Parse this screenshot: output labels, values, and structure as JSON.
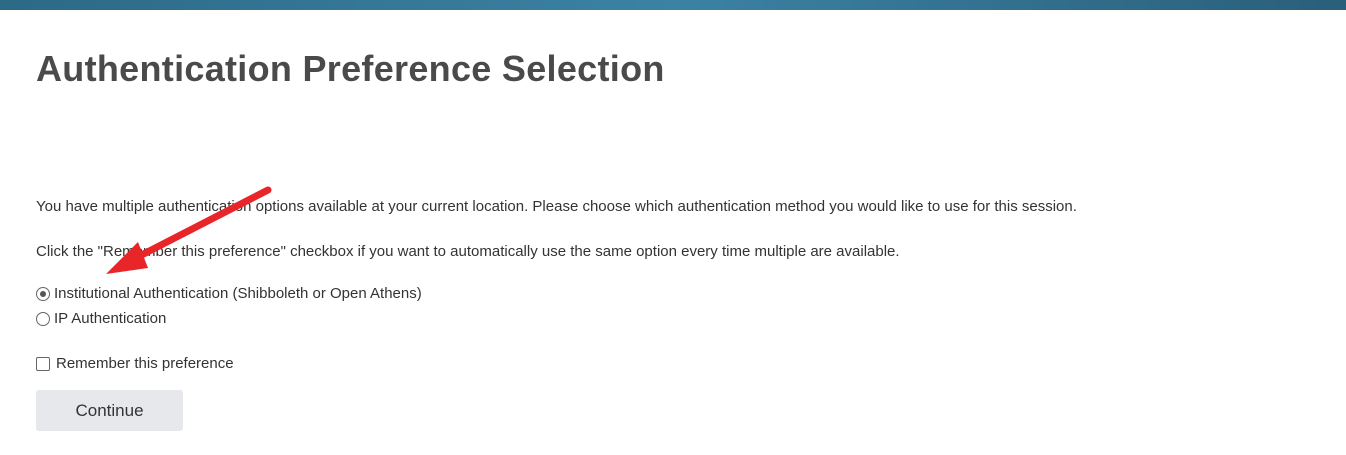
{
  "page": {
    "title": "Authentication Preference Selection",
    "intro_line_1": "You have multiple authentication options available at your current location. Please choose which authentication method you would like to use for this session.",
    "intro_line_2": "Click the \"Remember this preference\" checkbox if you want to automatically use the same option every time multiple are available."
  },
  "options": [
    {
      "label": "Institutional Authentication (Shibboleth or Open Athens)",
      "selected": true
    },
    {
      "label": "IP Authentication",
      "selected": false
    }
  ],
  "remember": {
    "label": "Remember this preference",
    "checked": false
  },
  "continue_label": "Continue",
  "colors": {
    "header_bar": "#2c6a86",
    "button_bg": "#e6e8ec",
    "annotation_arrow": "#e8262a"
  }
}
